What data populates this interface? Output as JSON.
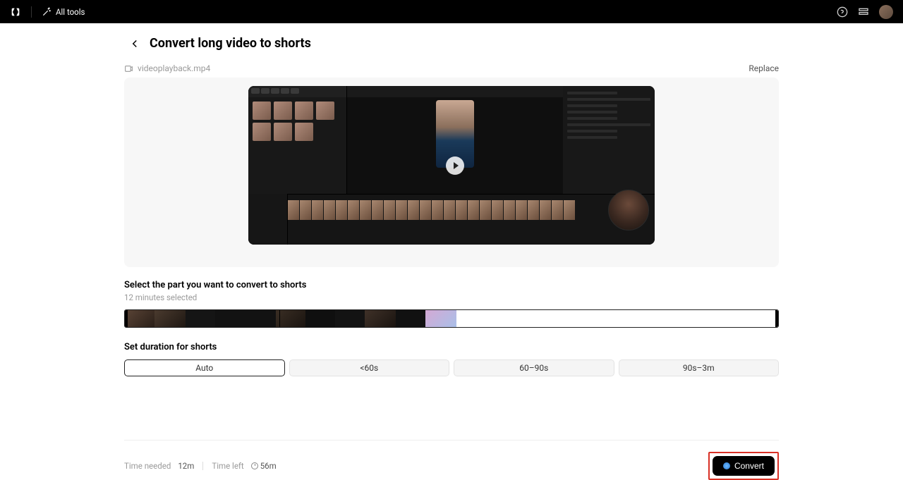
{
  "topbar": {
    "all_tools": "All tools"
  },
  "page": {
    "title": "Convert long video to shorts",
    "filename": "videoplayback.mp4",
    "replace": "Replace"
  },
  "select": {
    "label": "Select the part you want to convert to shorts",
    "sub": "12 minutes selected"
  },
  "duration": {
    "label": "Set duration for shorts",
    "opts": [
      "Auto",
      "<60s",
      "60–90s",
      "90s–3m"
    ]
  },
  "footer": {
    "time_needed_label": "Time needed",
    "time_needed_value": "12m",
    "time_left_label": "Time left",
    "time_left_value": "56m",
    "convert": "Convert"
  }
}
